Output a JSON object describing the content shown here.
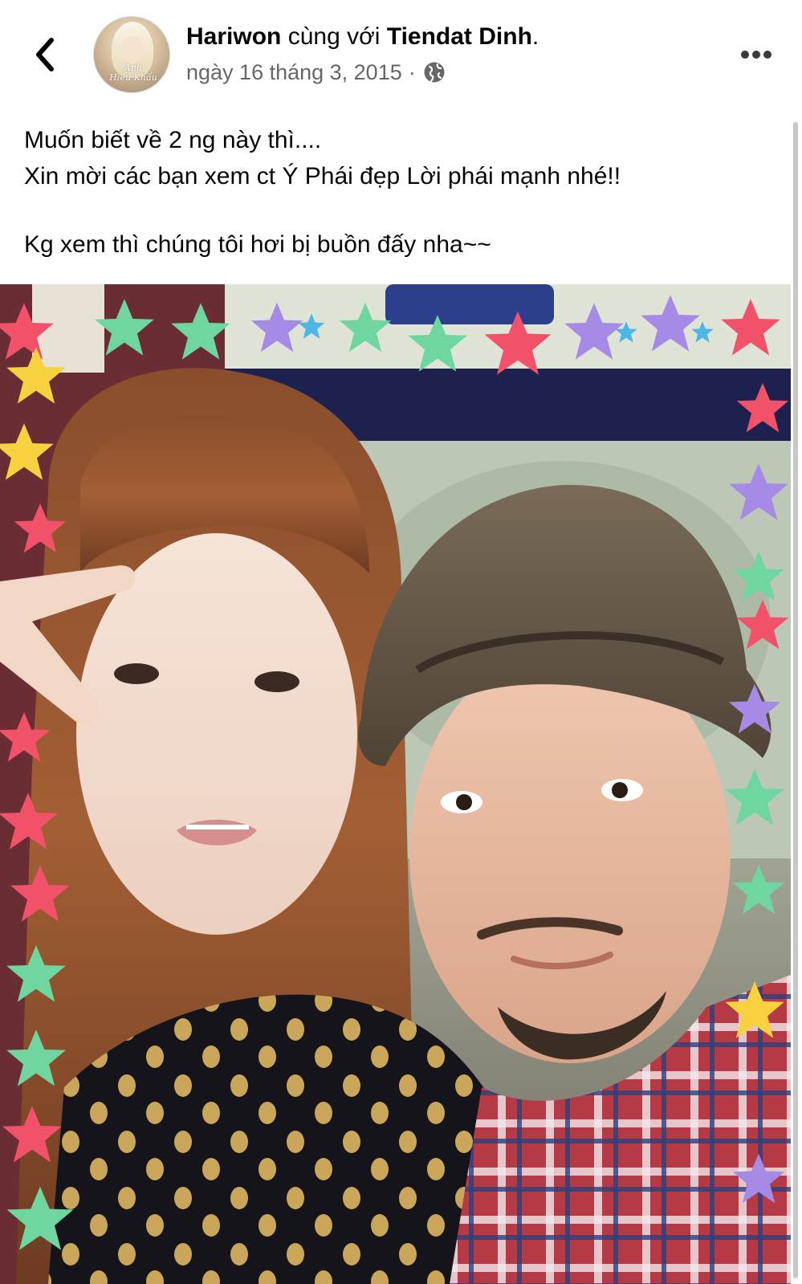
{
  "header": {
    "author": "Hariwon",
    "with_word": "cùng với",
    "tagged": "Tiendat Dinh",
    "period": ".",
    "date": "ngày 16 tháng 3, 2015",
    "separator": "·",
    "privacy_icon": "globe-icon",
    "back_icon": "chevron-left-icon",
    "more_icon": "more-horizontal-icon",
    "avatar_text_1": "Anh",
    "avatar_text_2": "Hiểu Khẩu"
  },
  "post": {
    "line1": "Muốn biết về 2 ng này thì....",
    "line2": "Xin mời các bạn xem ct Ý Phái đẹp Lời phái mạnh nhé!!",
    "line3": "Kg xem thì chúng tôi hơi bị buồn đấy nha~~"
  },
  "colors": {
    "text": "#050505",
    "secondary": "#65676b",
    "background": "#ffffff"
  }
}
